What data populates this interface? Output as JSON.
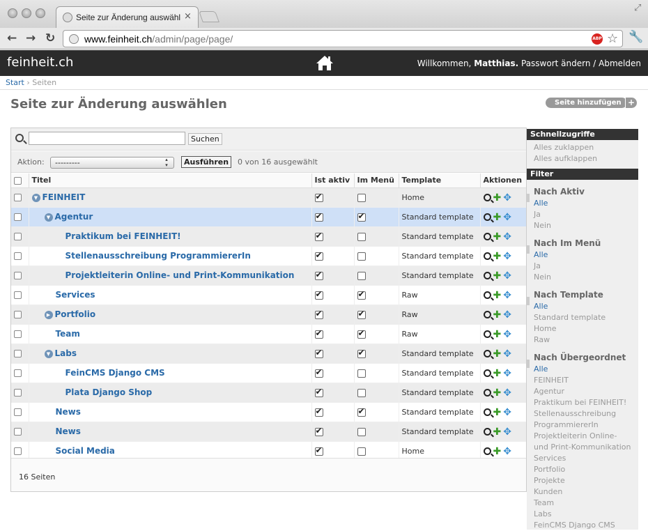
{
  "browser": {
    "tab_title": "Seite zur Änderung auswählen",
    "close_glyph": "×",
    "url_host": "www.feinheit.ch",
    "url_path": "/admin/page/page/",
    "back_glyph": "←",
    "forward_glyph": "→",
    "reload_glyph": "↻",
    "abp_label": "ABP",
    "star_glyph": "☆",
    "wrench_glyph": "🔧",
    "resize_glyph": "⤢"
  },
  "header": {
    "brand": "feinheit.ch",
    "welcome": "Willkommen,",
    "user": "Matthias.",
    "change_password": "Passwort ändern",
    "separator": "/",
    "logout": "Abmelden"
  },
  "breadcrumbs": {
    "start": "Start",
    "separator": "›",
    "current": "Seiten"
  },
  "page": {
    "title": "Seite zur Änderung auswählen",
    "add_label": "Seite hinzufügen",
    "add_plus": "+"
  },
  "search": {
    "value": "",
    "button": "Suchen"
  },
  "actions": {
    "label": "Aktion:",
    "selected": "---------",
    "go": "Ausführen",
    "count": "0 von 16 ausgewählt"
  },
  "table": {
    "headers": [
      "Titel",
      "Ist aktiv",
      "Im Menü",
      "Template",
      "Aktionen"
    ],
    "rows": [
      {
        "title": "FEINHEIT",
        "indent": 0,
        "toggle": "down",
        "active": true,
        "menu": false,
        "template": "Home"
      },
      {
        "title": "Agentur",
        "indent": 1,
        "toggle": "down",
        "active": true,
        "menu": true,
        "template": "Standard template"
      },
      {
        "title": "Praktikum bei FEINHEIT!",
        "indent": 2,
        "toggle": "",
        "active": true,
        "menu": false,
        "template": "Standard template"
      },
      {
        "title": "Stellenausschreibung ProgrammiererIn",
        "indent": 2,
        "toggle": "",
        "active": true,
        "menu": false,
        "template": "Standard template"
      },
      {
        "title": "Projektleiterin Online- und Print-Kommunikation",
        "indent": 2,
        "toggle": "",
        "active": true,
        "menu": false,
        "template": "Standard template"
      },
      {
        "title": "Services",
        "indent": 1,
        "toggle": "",
        "active": true,
        "menu": true,
        "template": "Raw"
      },
      {
        "title": "Portfolio",
        "indent": 1,
        "toggle": "right",
        "active": true,
        "menu": true,
        "template": "Raw"
      },
      {
        "title": "Team",
        "indent": 1,
        "toggle": "",
        "active": true,
        "menu": true,
        "template": "Raw"
      },
      {
        "title": "Labs",
        "indent": 1,
        "toggle": "down",
        "active": true,
        "menu": true,
        "template": "Standard template"
      },
      {
        "title": "FeinCMS Django CMS",
        "indent": 2,
        "toggle": "",
        "active": true,
        "menu": false,
        "template": "Standard template"
      },
      {
        "title": "Plata Django Shop",
        "indent": 2,
        "toggle": "",
        "active": true,
        "menu": false,
        "template": "Standard template"
      },
      {
        "title": "News",
        "indent": 1,
        "toggle": "",
        "active": true,
        "menu": true,
        "template": "Standard template"
      },
      {
        "title": "News",
        "indent": 1,
        "toggle": "",
        "active": true,
        "menu": false,
        "template": "Standard template"
      },
      {
        "title": "Social Media",
        "indent": 1,
        "toggle": "",
        "active": true,
        "menu": false,
        "template": "Home"
      }
    ]
  },
  "paginator": "16 Seiten",
  "sidebar": {
    "shortcuts_title": "Schnellzugriffe",
    "shortcuts": [
      "Alles zuklappen",
      "Alles aufklappen"
    ],
    "filter_title": "Filter",
    "filters": [
      {
        "title": "Nach Aktiv",
        "options": [
          "Alle",
          "Ja",
          "Nein"
        ]
      },
      {
        "title": "Nach Im Menü",
        "options": [
          "Alle",
          "Ja",
          "Nein"
        ]
      },
      {
        "title": "Nach Template",
        "options": [
          "Alle",
          "Standard template",
          "Home",
          "Raw"
        ]
      },
      {
        "title": "Nach Übergeordnet",
        "options": [
          "Alle",
          "FEINHEIT",
          "Agentur",
          "Praktikum bei FEINHEIT!",
          "Stellenausschreibung",
          "ProgrammiererIn",
          "Projektleiterin Online-",
          "und Print-Kommunikation",
          "Services",
          "Portfolio",
          "Projekte",
          "Kunden",
          "Team",
          "Labs",
          "FeinCMS Django CMS"
        ]
      }
    ]
  },
  "colors": {
    "header_bg": "#2b2b2b",
    "link": "#2a6aa8",
    "selected_row": "#cfe0f7"
  }
}
